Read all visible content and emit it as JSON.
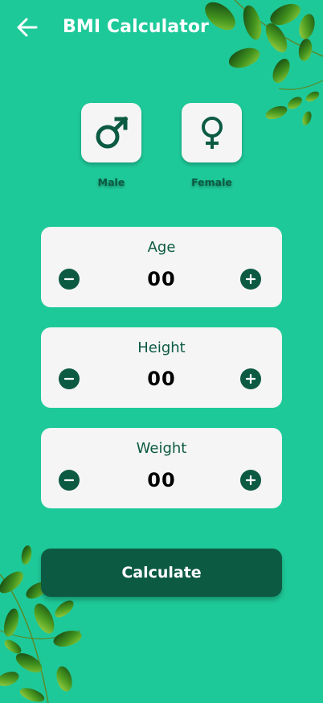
{
  "header": {
    "title": "BMI Calculator",
    "back_icon": "arrow-left-icon"
  },
  "gender": {
    "options": [
      {
        "label": "Male",
        "icon": "male-symbol-icon"
      },
      {
        "label": "Female",
        "icon": "female-symbol-icon"
      }
    ]
  },
  "steppers": [
    {
      "label": "Age",
      "value": "00"
    },
    {
      "label": "Height",
      "value": "00"
    },
    {
      "label": "Weight",
      "value": "00"
    }
  ],
  "actions": {
    "calculate_label": "Calculate"
  },
  "colors": {
    "background": "#1ec999",
    "accent": "#0d5a43",
    "card": "#f5f5f5",
    "header_text": "#ffffff"
  }
}
